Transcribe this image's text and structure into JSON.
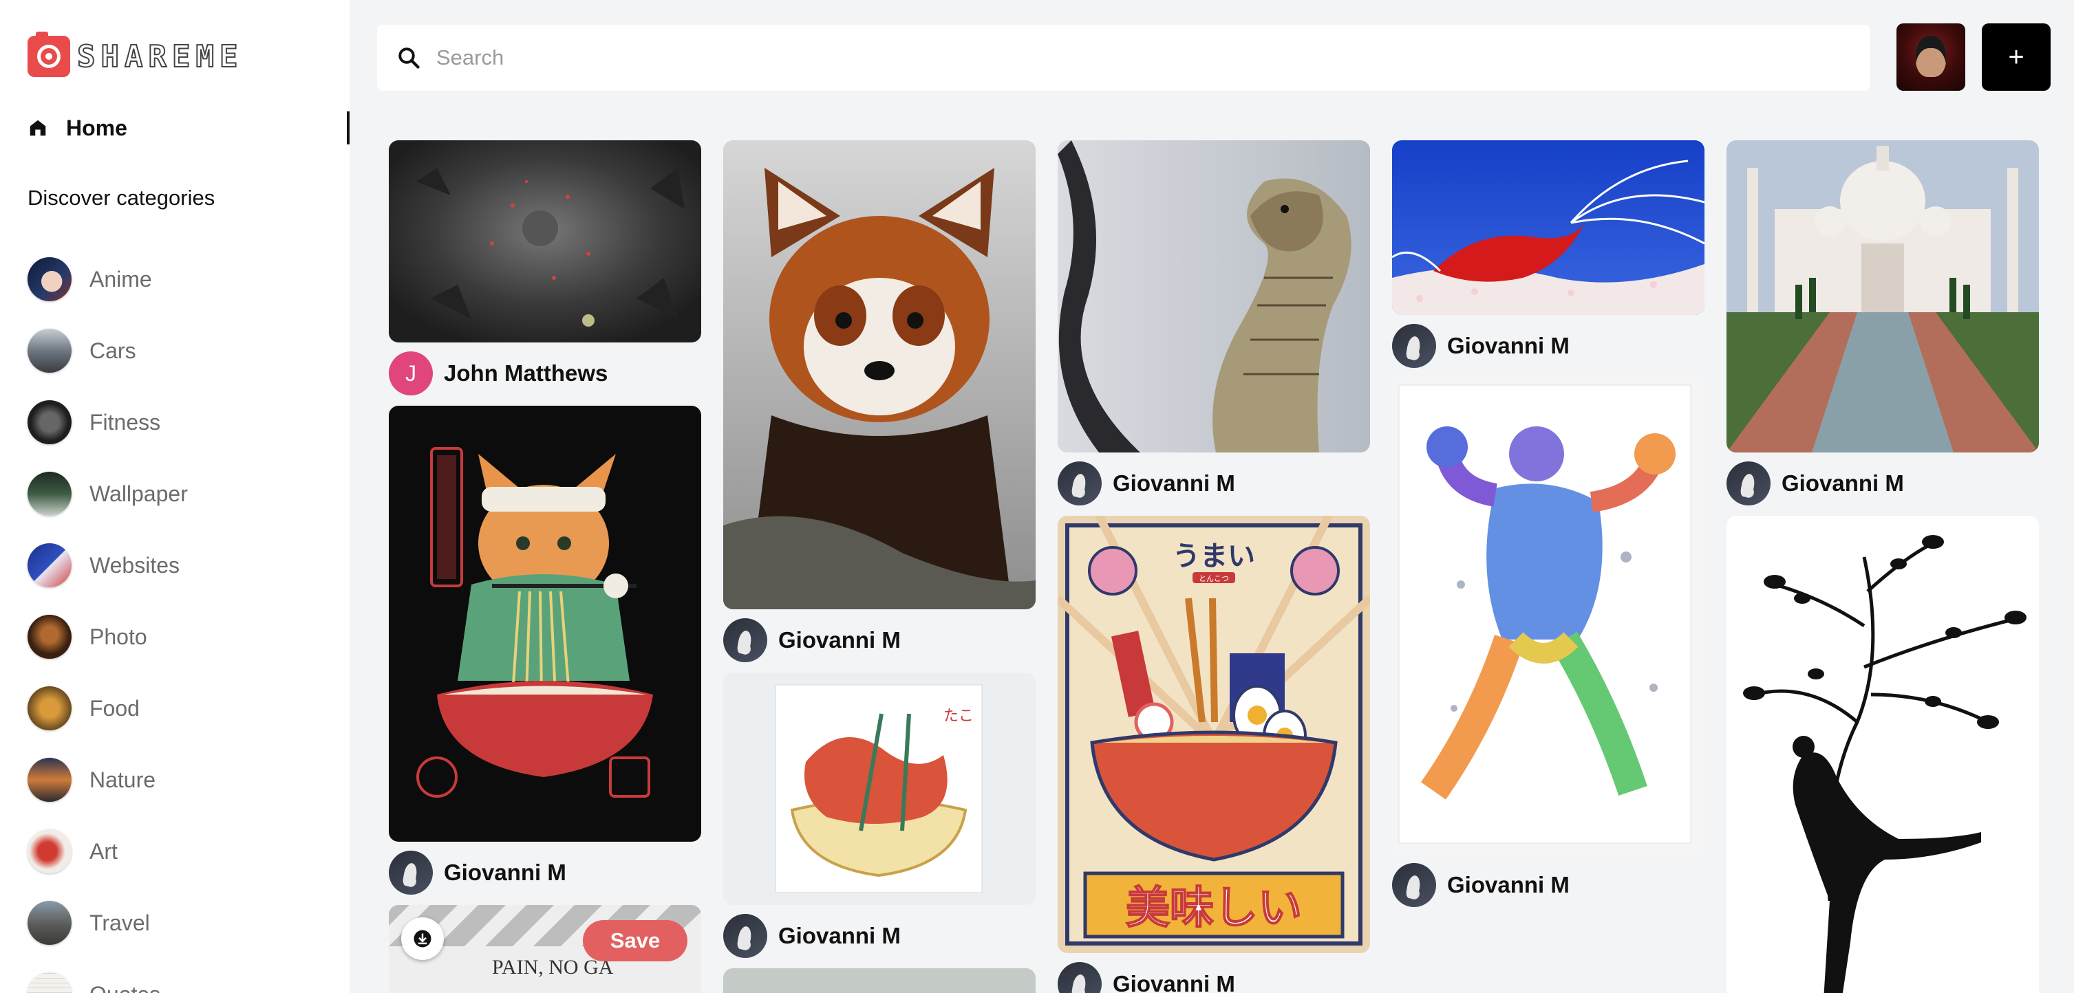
{
  "app": {
    "logo_text": "SHAREME",
    "brand_color": "#e94b4b"
  },
  "sidebar": {
    "home_label": "Home",
    "categories_title": "Discover categories",
    "categories": [
      {
        "label": "Anime"
      },
      {
        "label": "Cars"
      },
      {
        "label": "Fitness"
      },
      {
        "label": "Wallpaper"
      },
      {
        "label": "Websites"
      },
      {
        "label": "Photo"
      },
      {
        "label": "Food"
      },
      {
        "label": "Nature"
      },
      {
        "label": "Art"
      },
      {
        "label": "Travel"
      },
      {
        "label": "Quotes"
      }
    ]
  },
  "header": {
    "search_placeholder": "Search",
    "search_value": "",
    "add_label": "+"
  },
  "feed": {
    "col1": {
      "pin1_author": "John Matthews",
      "pin1_initial": "J",
      "pin2_author": "Giovanni M",
      "pin3_save_label": "Save",
      "pin3_text": "PAIN, NO GA"
    },
    "col2": {
      "pin1_author": "Giovanni M",
      "pin2_author": "Giovanni M"
    },
    "col3": {
      "pin1_author": "Giovanni M",
      "pin2_jp_top": "うまい",
      "pin2_jp_sub": "とんこつ",
      "pin2_jp_bottom": "美味しい",
      "pin2_author": "Giovanni M"
    },
    "col4": {
      "pin1_author": "Giovanni M",
      "pin2_author": "Giovanni M"
    },
    "col5": {
      "pin1_author": "Giovanni M"
    }
  }
}
